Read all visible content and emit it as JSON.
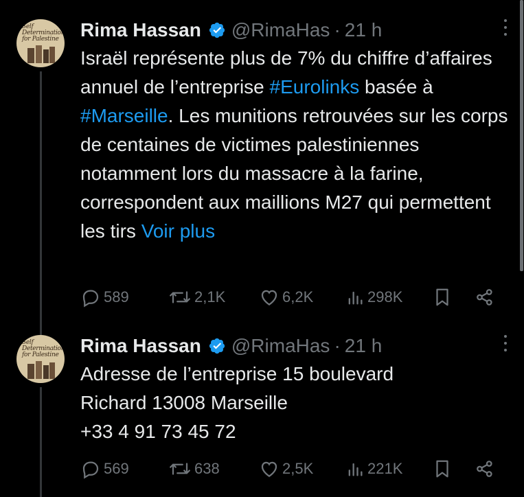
{
  "tweets": [
    {
      "avatar_text": [
        "Self",
        "Determination",
        "for Palestine"
      ],
      "name": "Rima Hassan",
      "handle": "@RimaHas",
      "dot": "·",
      "time": "21 h",
      "text_parts": [
        {
          "text": "Israël représente plus de 7% du chiffre d’affaires annuel de l’entreprise ",
          "link": false
        },
        {
          "text": "#Eurolinks",
          "link": true
        },
        {
          "text": " basée à ",
          "link": false
        },
        {
          "text": "#Marseille",
          "link": true
        },
        {
          "text": ". Les munitions retrouvées sur les corps de centaines de victimes palestiniennes notamment lors du massacre à la farine, correspondent aux maillions M27 qui permettent les tirs ",
          "link": false
        },
        {
          "text": "Voir plus",
          "link": true
        }
      ],
      "replies": "589",
      "reposts": "2,1K",
      "likes": "6,2K",
      "views": "298K"
    },
    {
      "avatar_text": [
        "Self",
        "Determination",
        "for Palestine"
      ],
      "name": "Rima Hassan",
      "handle": "@RimaHas",
      "dot": "·",
      "time": "21 h",
      "text_parts": [
        {
          "text": "Adresse de l’entreprise 15 boulevard Richard 13008 Marseille",
          "link": false
        },
        {
          "text": "+33 4 91 73 45 72",
          "link": false
        }
      ],
      "replies": "569",
      "reposts": "638",
      "likes": "2,5K",
      "views": "221K"
    }
  ],
  "colors": {
    "background": "#000000",
    "text": "#e7e9ea",
    "muted": "#71767b",
    "link": "#1d9bf0",
    "verified": "#1d9bf0"
  },
  "icons": [
    "verified-badge-icon",
    "more-icon",
    "reply-icon",
    "repost-icon",
    "like-icon",
    "views-icon",
    "bookmark-icon",
    "share-icon"
  ]
}
